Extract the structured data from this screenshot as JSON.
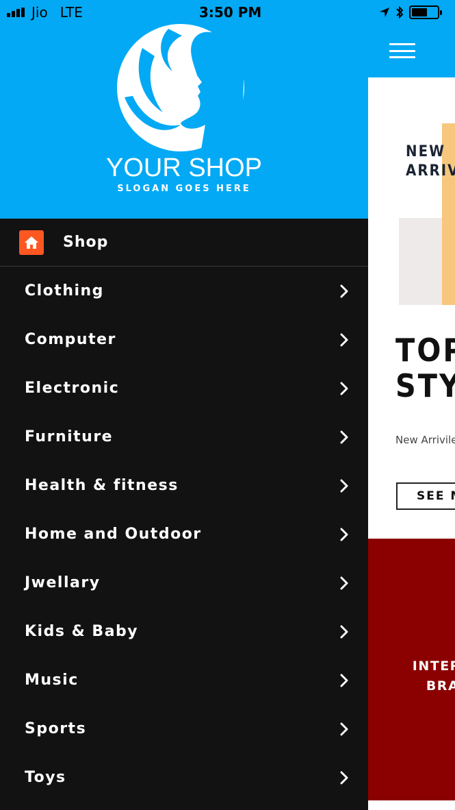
{
  "status": {
    "carrier": "Jio",
    "network": "LTE",
    "time": "3:50 PM",
    "signal_bars": 4,
    "battery_level": 0.62
  },
  "drawer": {
    "brand": {
      "name": "YOUR SHOP",
      "slogan": "SLOGAN GOES HERE"
    },
    "shop_label": "Shop",
    "items": [
      {
        "label": "Clothing"
      },
      {
        "label": "Computer"
      },
      {
        "label": "Electronic"
      },
      {
        "label": "Furniture"
      },
      {
        "label": "Health & fitness"
      },
      {
        "label": "Home and Outdoor"
      },
      {
        "label": "Jwellary"
      },
      {
        "label": "Kids & Baby"
      },
      {
        "label": "Music"
      },
      {
        "label": "Sports"
      },
      {
        "label": "Toys"
      }
    ]
  },
  "background_page": {
    "hero_tag": "NEW\nARRIV",
    "hero_title": "TOP\nSTYI",
    "hero_subtitle": "New Arrivile",
    "hero_button": "SEE M",
    "promo_text": "INTERN\nBRA"
  },
  "colors": {
    "header_blue": "#03a9f4",
    "drawer_bg": "#121212",
    "home_badge": "#ff5722",
    "promo_red": "#8b0000",
    "hero_orange": "#f6c77c"
  }
}
